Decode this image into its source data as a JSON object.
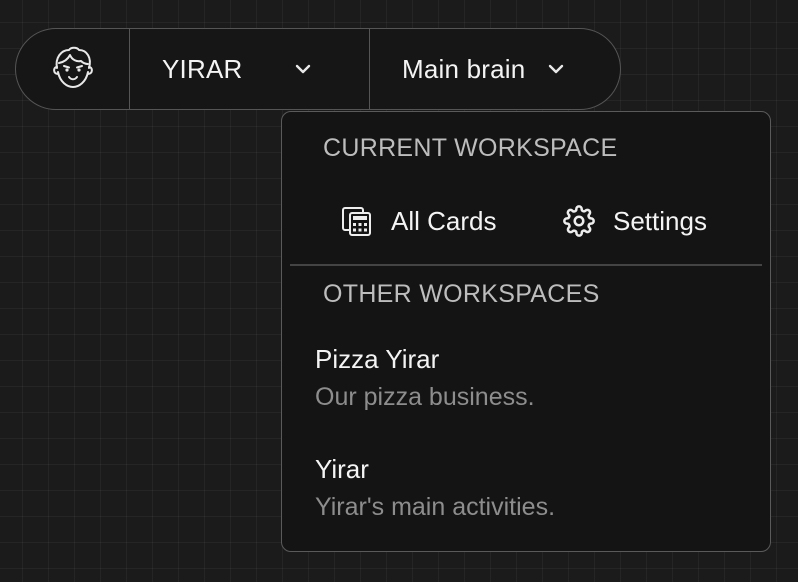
{
  "toolbar": {
    "avatar_icon": "user-face-icon",
    "user_name": "YIRAR",
    "brain_name": "Main brain",
    "chevron_icon": "chevron-down-icon"
  },
  "dropdown": {
    "current_heading": "CURRENT WORKSPACE",
    "actions": [
      {
        "label": "All Cards",
        "icon": "calculator-grid-icon"
      },
      {
        "label": "Settings",
        "icon": "gear-icon"
      }
    ],
    "other_heading": "OTHER WORKSPACES",
    "workspaces": [
      {
        "name": "Pizza Yirar",
        "description": "Our pizza business."
      },
      {
        "name": "Yirar",
        "description": "Yirar's main activities."
      }
    ]
  },
  "colors": {
    "background": "#1b1b1b",
    "panel": "#141414",
    "border": "#555555",
    "text": "#f4f4f4",
    "muted": "#8d8d8d",
    "heading": "#bdbdbd"
  }
}
